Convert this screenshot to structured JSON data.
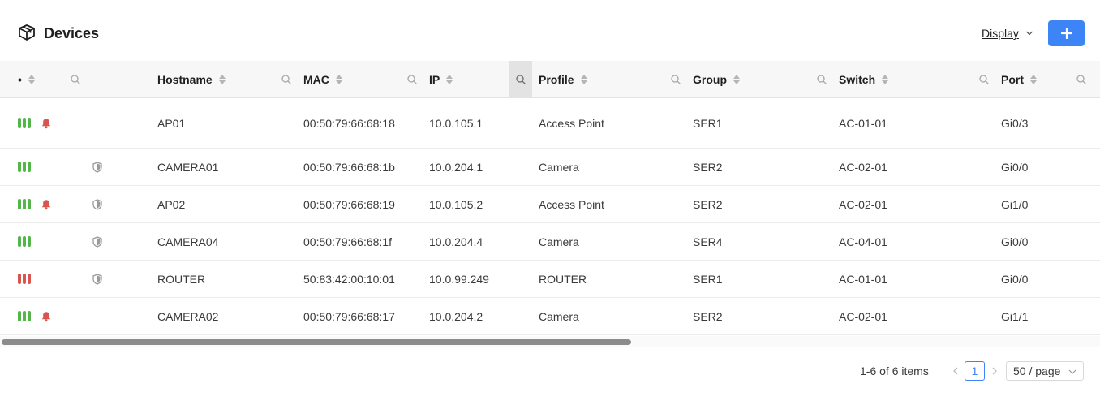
{
  "header": {
    "title": "Devices",
    "display_label": "Display",
    "add_label": "+"
  },
  "columns": [
    {
      "key": "status",
      "label": "•"
    },
    {
      "key": "hostname",
      "label": "Hostname"
    },
    {
      "key": "mac",
      "label": "MAC"
    },
    {
      "key": "ip",
      "label": "IP"
    },
    {
      "key": "profile",
      "label": "Profile"
    },
    {
      "key": "group",
      "label": "Group"
    },
    {
      "key": "switch",
      "label": "Switch"
    },
    {
      "key": "port",
      "label": "Port"
    }
  ],
  "colors": {
    "accent": "#3d84f6",
    "signal_ok": "#52b748",
    "signal_bad": "#d9534f",
    "alert": "#d9534f",
    "shield": "#9a9a9a"
  },
  "rows": [
    {
      "signal": "ok",
      "alert": true,
      "shield": false,
      "hostname": "AP01",
      "mac": "00:50:79:66:68:18",
      "ip": "10.0.105.1",
      "profile": "Access Point",
      "group": "SER1",
      "switch": "AC-01-01",
      "port": "Gi0/3"
    },
    {
      "signal": "ok",
      "alert": false,
      "shield": true,
      "hostname": "CAMERA01",
      "mac": "00:50:79:66:68:1b",
      "ip": "10.0.204.1",
      "profile": "Camera",
      "group": "SER2",
      "switch": "AC-02-01",
      "port": "Gi0/0"
    },
    {
      "signal": "ok",
      "alert": true,
      "shield": true,
      "hostname": "AP02",
      "mac": "00:50:79:66:68:19",
      "ip": "10.0.105.2",
      "profile": "Access Point",
      "group": "SER2",
      "switch": "AC-02-01",
      "port": "Gi1/0"
    },
    {
      "signal": "ok",
      "alert": false,
      "shield": true,
      "hostname": "CAMERA04",
      "mac": "00:50:79:66:68:1f",
      "ip": "10.0.204.4",
      "profile": "Camera",
      "group": "SER4",
      "switch": "AC-04-01",
      "port": "Gi0/0"
    },
    {
      "signal": "bad",
      "alert": false,
      "shield": true,
      "hostname": "ROUTER",
      "mac": "50:83:42:00:10:01",
      "ip": "10.0.99.249",
      "profile": "ROUTER",
      "group": "SER1",
      "switch": "AC-01-01",
      "port": "Gi0/0"
    },
    {
      "signal": "ok",
      "alert": true,
      "shield": false,
      "hostname": "CAMERA02",
      "mac": "00:50:79:66:68:17",
      "ip": "10.0.204.2",
      "profile": "Camera",
      "group": "SER2",
      "switch": "AC-02-01",
      "port": "Gi1/1"
    }
  ],
  "pagination": {
    "total_text": "1-6 of 6 items",
    "current_page": "1",
    "page_size": "50 / page"
  }
}
